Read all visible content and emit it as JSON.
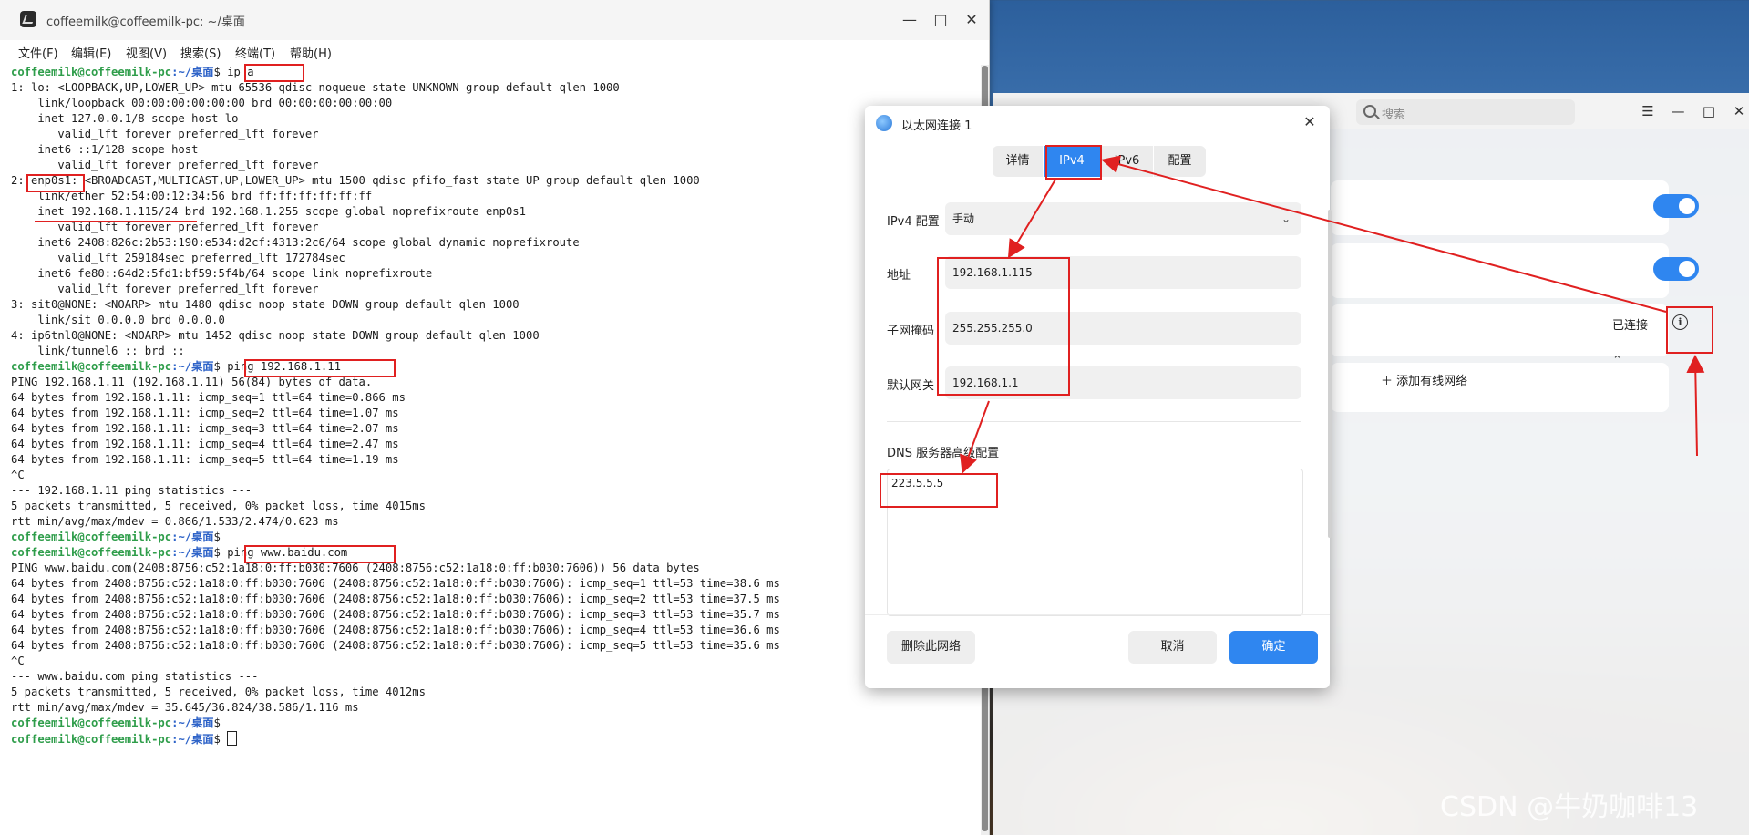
{
  "terminal": {
    "title": "coffeemilk@coffeemilk-pc: ~/桌面",
    "menu": [
      "文件(F)",
      "编辑(E)",
      "视图(V)",
      "搜索(S)",
      "终端(T)",
      "帮助(H)"
    ],
    "prompt_user": "coffeemilk@coffeemilk-pc",
    "prompt_path": ":~/桌面",
    "lines": [
      {
        "p": true,
        "cmd": "ip a"
      },
      {
        "t": "1: lo: <LOOPBACK,UP,LOWER_UP> mtu 65536 qdisc noqueue state UNKNOWN group default qlen 1000"
      },
      {
        "t": "    link/loopback 00:00:00:00:00:00 brd 00:00:00:00:00:00"
      },
      {
        "t": "    inet 127.0.0.1/8 scope host lo"
      },
      {
        "t": "       valid_lft forever preferred_lft forever"
      },
      {
        "t": "    inet6 ::1/128 scope host"
      },
      {
        "t": "       valid_lft forever preferred_lft forever"
      },
      {
        "t": "2: enp0s1: <BROADCAST,MULTICAST,UP,LOWER_UP> mtu 1500 qdisc pfifo_fast state UP group default qlen 1000"
      },
      {
        "t": "    link/ether 52:54:00:12:34:56 brd ff:ff:ff:ff:ff:ff"
      },
      {
        "t": "    inet 192.168.1.115/24 brd 192.168.1.255 scope global noprefixroute enp0s1"
      },
      {
        "t": "       valid_lft forever preferred_lft forever"
      },
      {
        "t": "    inet6 2408:826c:2b53:190:e534:d2cf:4313:2c6/64 scope global dynamic noprefixroute"
      },
      {
        "t": "       valid_lft 259184sec preferred_lft 172784sec"
      },
      {
        "t": "    inet6 fe80::64d2:5fd1:bf59:5f4b/64 scope link noprefixroute"
      },
      {
        "t": "       valid_lft forever preferred_lft forever"
      },
      {
        "t": "3: sit0@NONE: <NOARP> mtu 1480 qdisc noop state DOWN group default qlen 1000"
      },
      {
        "t": "    link/sit 0.0.0.0 brd 0.0.0.0"
      },
      {
        "t": "4: ip6tnl0@NONE: <NOARP> mtu 1452 qdisc noop state DOWN group default qlen 1000"
      },
      {
        "t": "    link/tunnel6 :: brd ::"
      },
      {
        "p": true,
        "cmd": "ping 192.168.1.11"
      },
      {
        "t": "PING 192.168.1.11 (192.168.1.11) 56(84) bytes of data."
      },
      {
        "t": "64 bytes from 192.168.1.11: icmp_seq=1 ttl=64 time=0.866 ms"
      },
      {
        "t": "64 bytes from 192.168.1.11: icmp_seq=2 ttl=64 time=1.07 ms"
      },
      {
        "t": "64 bytes from 192.168.1.11: icmp_seq=3 ttl=64 time=2.07 ms"
      },
      {
        "t": "64 bytes from 192.168.1.11: icmp_seq=4 ttl=64 time=2.47 ms"
      },
      {
        "t": "64 bytes from 192.168.1.11: icmp_seq=5 ttl=64 time=1.19 ms"
      },
      {
        "t": "^C"
      },
      {
        "t": "--- 192.168.1.11 ping statistics ---"
      },
      {
        "t": "5 packets transmitted, 5 received, 0% packet loss, time 4015ms"
      },
      {
        "t": "rtt min/avg/max/mdev = 0.866/1.533/2.474/0.623 ms"
      },
      {
        "p": true,
        "cmd": ""
      },
      {
        "p": true,
        "cmd": "ping www.baidu.com"
      },
      {
        "t": "PING www.baidu.com(2408:8756:c52:1a18:0:ff:b030:7606 (2408:8756:c52:1a18:0:ff:b030:7606)) 56 data bytes"
      },
      {
        "t": "64 bytes from 2408:8756:c52:1a18:0:ff:b030:7606 (2408:8756:c52:1a18:0:ff:b030:7606): icmp_seq=1 ttl=53 time=38.6 ms"
      },
      {
        "t": "64 bytes from 2408:8756:c52:1a18:0:ff:b030:7606 (2408:8756:c52:1a18:0:ff:b030:7606): icmp_seq=2 ttl=53 time=37.5 ms"
      },
      {
        "t": "64 bytes from 2408:8756:c52:1a18:0:ff:b030:7606 (2408:8756:c52:1a18:0:ff:b030:7606): icmp_seq=3 ttl=53 time=35.7 ms"
      },
      {
        "t": "64 bytes from 2408:8756:c52:1a18:0:ff:b030:7606 (2408:8756:c52:1a18:0:ff:b030:7606): icmp_seq=4 ttl=53 time=36.6 ms"
      },
      {
        "t": "64 bytes from 2408:8756:c52:1a18:0:ff:b030:7606 (2408:8756:c52:1a18:0:ff:b030:7606): icmp_seq=5 ttl=53 time=35.6 ms"
      },
      {
        "t": "^C"
      },
      {
        "t": "--- www.baidu.com ping statistics ---"
      },
      {
        "t": "5 packets transmitted, 5 received, 0% packet loss, time 4012ms"
      },
      {
        "t": "rtt min/avg/max/mdev = 35.645/36.824/38.586/1.116 ms"
      },
      {
        "p": true,
        "cmd": ""
      },
      {
        "p": true,
        "cmd": "",
        "cursor": true
      }
    ]
  },
  "settings": {
    "search_placeholder": "搜索",
    "connection_status": "已连接",
    "add_network": "添加有线网络",
    "add_icon": "plus-icon",
    "info_icon": "info-icon"
  },
  "dialog": {
    "title": "以太网连接 1",
    "tabs": [
      "详情",
      "IPv4",
      "IPv6",
      "配置"
    ],
    "active_tab": "IPv4",
    "ipv4_config_label": "IPv4 配置",
    "ipv4_config_value": "手动",
    "address_label": "地址",
    "address_value": "192.168.1.115",
    "netmask_label": "子网掩码",
    "netmask_value": "255.255.255.0",
    "gateway_label": "默认网关",
    "gateway_value": "192.168.1.1",
    "dns_label": "DNS 服务器高级配置",
    "dns_value": "223.5.5.5",
    "delete_button": "删除此网络",
    "cancel_button": "取消",
    "ok_button": "确定"
  },
  "colors": {
    "accent": "#2f86f0",
    "prompt_user": "#2e9d4a",
    "prompt_path": "#2e63c8",
    "annotation": "#e02020"
  },
  "watermark": "CSDN @牛奶咖啡13"
}
